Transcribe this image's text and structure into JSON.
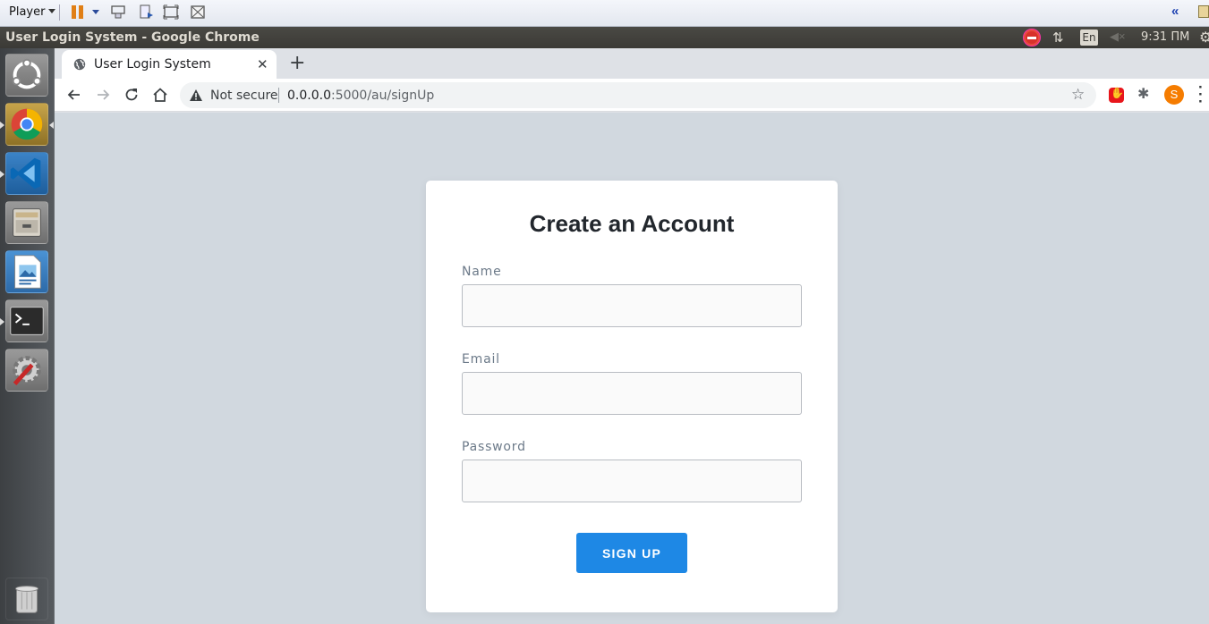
{
  "vm_toolbar": {
    "player_label": "Player",
    "icons": [
      "pause-icon",
      "send-ctrl-alt-del-icon",
      "removable-devices-icon",
      "fullscreen-icon",
      "unity-mode-icon"
    ]
  },
  "top_panel": {
    "window_title": "User Login System - Google Chrome",
    "keyboard_layout": "En",
    "time": "9:31 ПМ"
  },
  "launcher": {
    "items": [
      "ubuntu-dash-icon",
      "chrome-icon",
      "vscode-icon",
      "file-manager-icon",
      "libreoffice-impress-icon",
      "terminal-icon",
      "system-settings-icon",
      "trash-icon"
    ]
  },
  "browser": {
    "tab_title": "User Login System",
    "new_tab": "+",
    "security_text": "Not secure",
    "url_host": "0.0.0.0",
    "url_rest": ":5000/au/signUp",
    "profile_initial": "S"
  },
  "form": {
    "title": "Create an Account",
    "fields": [
      {
        "label": "Name",
        "value": "",
        "placeholder": ""
      },
      {
        "label": "Email",
        "value": "",
        "placeholder": ""
      },
      {
        "label": "Password",
        "value": "",
        "placeholder": ""
      }
    ],
    "submit_label": "SIGN UP"
  },
  "colors": {
    "page_background": "#d1d8df",
    "card_background": "#ffffff",
    "button": "#1e88e5",
    "profile_avatar": "#f57c00"
  }
}
